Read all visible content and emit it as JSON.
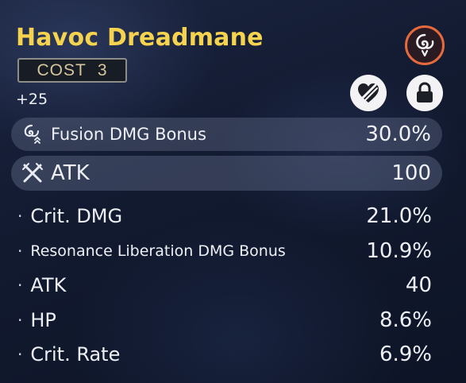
{
  "echo": {
    "name": "Havoc Dreadmane",
    "cost_label": "COST",
    "cost_value": "3",
    "level": "+25",
    "element_icon": "havoc-element-icon",
    "element_color": "#e56a3e",
    "name_color": "#f5d34e"
  },
  "actions": {
    "discard_icon": "heart-slash-icon",
    "lock_icon": "lock-icon"
  },
  "main_stat": {
    "icon": "havoc-dmg-icon",
    "label": "Fusion DMG Bonus",
    "value": "30.0%"
  },
  "fixed_stat": {
    "icon": "crossed-swords-icon",
    "label": "ATK",
    "value": "100"
  },
  "sub_stats": [
    {
      "label": "Crit. DMG",
      "value": "21.0%"
    },
    {
      "label": "Resonance Liberation DMG Bonus",
      "value": "10.9%"
    },
    {
      "label": "ATK",
      "value": "40"
    },
    {
      "label": "HP",
      "value": "8.6%"
    },
    {
      "label": "Crit. Rate",
      "value": "6.9%"
    }
  ],
  "bullet": "·"
}
